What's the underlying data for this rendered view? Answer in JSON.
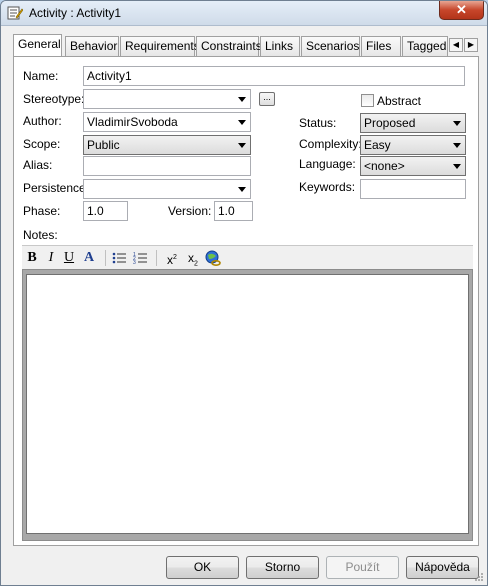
{
  "window": {
    "title": "Activity : Activity1",
    "close_label": "✕"
  },
  "tabs": [
    "General",
    "Behavior",
    "Requirements",
    "Constraints",
    "Links",
    "Scenarios",
    "Files",
    "Tagged"
  ],
  "tab_scroll": {
    "left": "◀",
    "right": "▶"
  },
  "form": {
    "name_label": "Name:",
    "name_value": "Activity1",
    "stereotype_label": "Stereotype:",
    "stereotype_value": "",
    "browse_label": "...",
    "abstract_label": "Abstract",
    "author_label": "Author:",
    "author_value": "VladimirSvoboda",
    "status_label": "Status:",
    "status_value": "Proposed",
    "scope_label": "Scope:",
    "scope_value": "Public",
    "complexity_label": "Complexity:",
    "complexity_value": "Easy",
    "alias_label": "Alias:",
    "alias_value": "",
    "language_label": "Language:",
    "language_value": "<none>",
    "persistence_label": "Persistence:",
    "persistence_value": "",
    "keywords_label": "Keywords:",
    "keywords_value": "",
    "phase_label": "Phase:",
    "phase_value": "1.0",
    "version_label": "Version:",
    "version_value": "1.0",
    "notes_label": "Notes:"
  },
  "notes_toolbar": {
    "bold": "B",
    "italic": "I",
    "underline": "U",
    "font_color": "A",
    "superscript": "x",
    "superscript_sup": "2",
    "subscript": "x",
    "subscript_sub": "2"
  },
  "buttons": {
    "ok": "OK",
    "cancel": "Storno",
    "apply": "Použít",
    "help": "Nápověda"
  },
  "colors": {
    "title_gradient_top": "#e5eef8",
    "close_red": "#c7462b",
    "dialog_bg": "#f0f0f0"
  }
}
